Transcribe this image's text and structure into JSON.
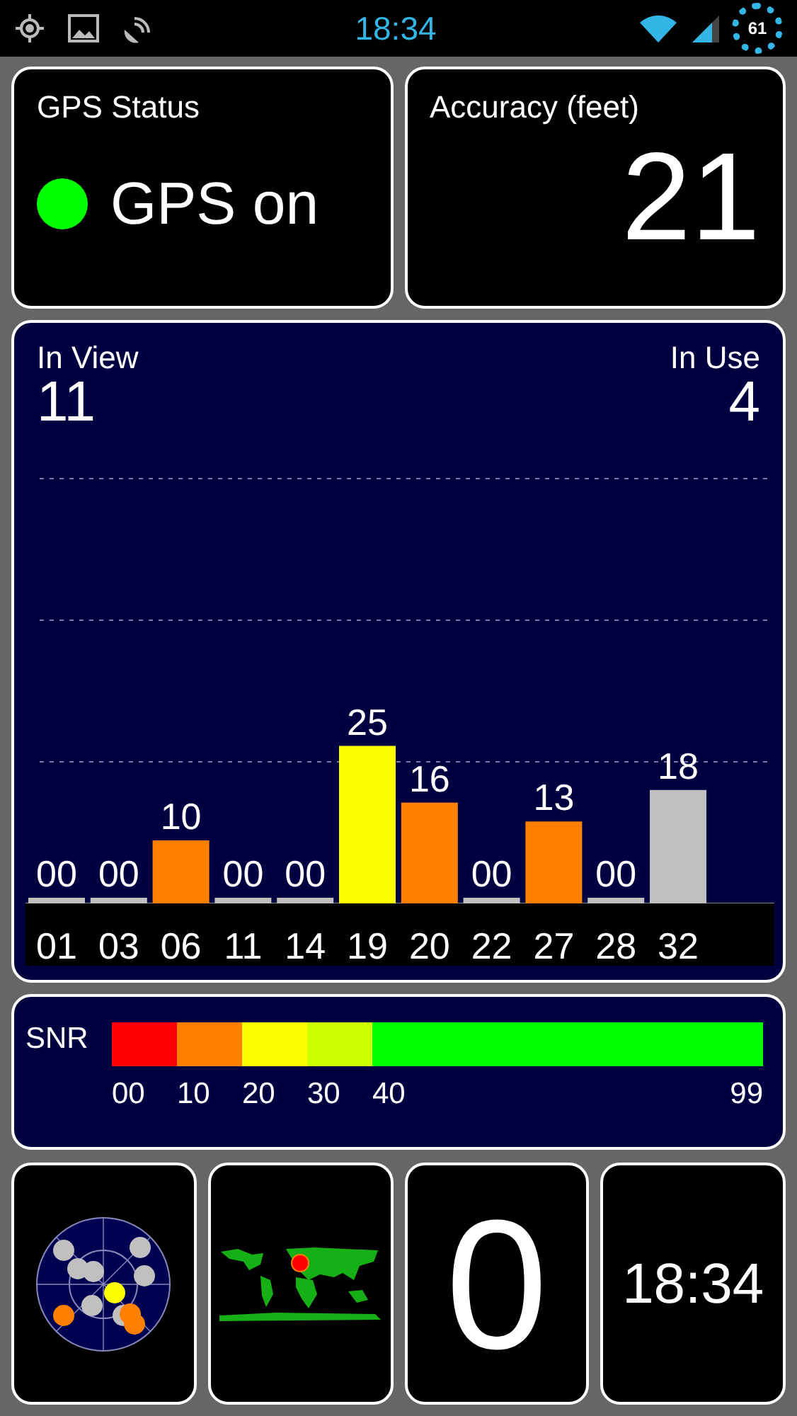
{
  "status_bar": {
    "time": "18:34",
    "battery": "61"
  },
  "gps_status": {
    "title": "GPS Status",
    "state": "GPS on",
    "on": true
  },
  "accuracy": {
    "title": "Accuracy (feet)",
    "value": "21"
  },
  "satellites": {
    "in_view_label": "In View",
    "in_view": "11",
    "in_use_label": "In Use",
    "in_use": "4",
    "chart_data": {
      "type": "bar",
      "categories": [
        "01",
        "03",
        "06",
        "11",
        "14",
        "19",
        "20",
        "22",
        "27",
        "28",
        "32"
      ],
      "values": [
        0,
        0,
        10,
        0,
        0,
        25,
        16,
        0,
        13,
        0,
        18
      ],
      "value_labels": [
        "00",
        "00",
        "10",
        "00",
        "00",
        "25",
        "16",
        "00",
        "13",
        "00",
        "18"
      ],
      "colors": [
        "#c0c0c0",
        "#c0c0c0",
        "#ff8000",
        "#c0c0c0",
        "#c0c0c0",
        "#ffff00",
        "#ff8000",
        "#c0c0c0",
        "#ff8000",
        "#c0c0c0",
        "#c0c0c0"
      ],
      "data_labels": true
    }
  },
  "snr": {
    "label": "SNR",
    "segments": [
      {
        "color": "#ff0000"
      },
      {
        "color": "#ff8000"
      },
      {
        "color": "#ffff00"
      },
      {
        "color": "#ccff00"
      },
      {
        "color": "#00ff00"
      }
    ],
    "ticks": [
      "00",
      "10",
      "20",
      "30",
      "40",
      "99"
    ]
  },
  "tiles": {
    "count": "0",
    "time": "18:34"
  }
}
